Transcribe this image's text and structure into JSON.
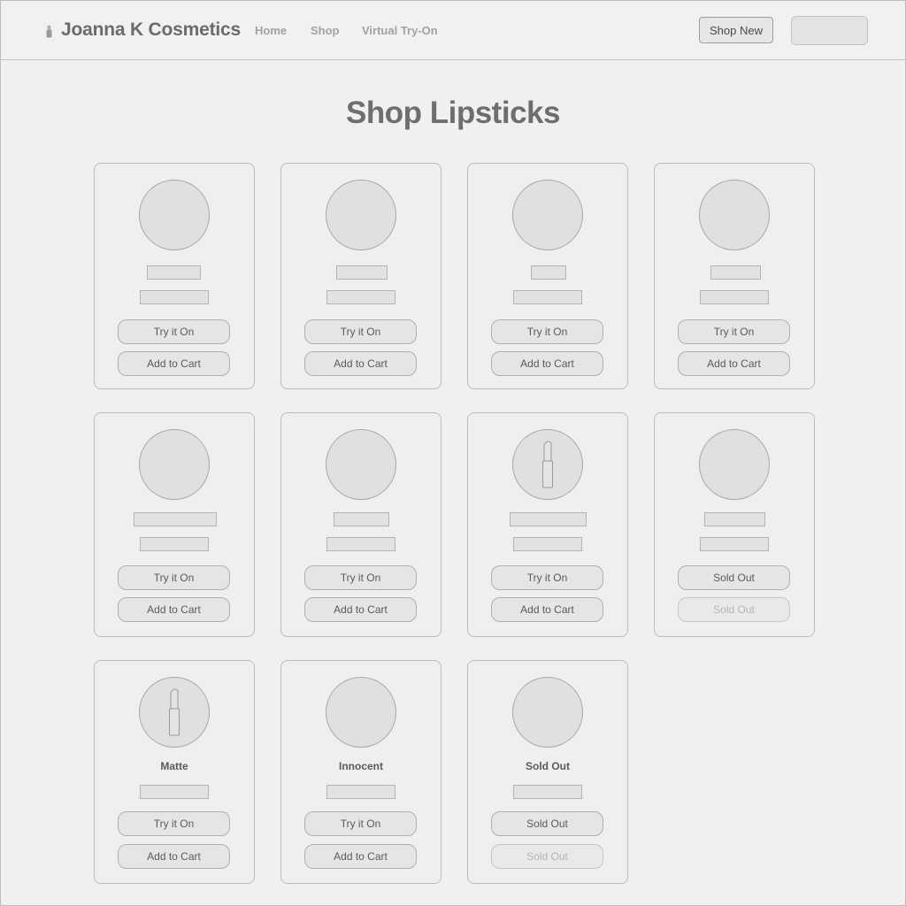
{
  "header": {
    "brand": "Joanna K Cosmetics",
    "nav": [
      "Home",
      "Shop",
      "Virtual Try-On"
    ],
    "shop_new_label": "Shop New"
  },
  "page": {
    "title": "Shop Lipsticks"
  },
  "products": [
    {
      "label": "",
      "primary_action": "Try it On",
      "secondary_action": "Add to Cart",
      "icon": "",
      "sold_out": false
    },
    {
      "label": "",
      "primary_action": "Try it On",
      "secondary_action": "Add to Cart",
      "icon": "",
      "sold_out": false
    },
    {
      "label": "",
      "primary_action": "Try it On",
      "secondary_action": "Add to Cart",
      "icon": "",
      "sold_out": false
    },
    {
      "label": "",
      "primary_action": "Try it On",
      "secondary_action": "Add to Cart",
      "icon": "",
      "sold_out": false
    },
    {
      "label": "",
      "primary_action": "Try it On",
      "secondary_action": "Add to Cart",
      "icon": "",
      "sold_out": false
    },
    {
      "label": "",
      "primary_action": "Try it On",
      "secondary_action": "Add to Cart",
      "icon": "",
      "sold_out": false
    },
    {
      "label": "",
      "primary_action": "Try it On",
      "secondary_action": "Add to Cart",
      "icon": "lipstick-icon",
      "sold_out": false
    },
    {
      "label": "",
      "primary_action": "Sold Out",
      "secondary_action": "Sold Out",
      "icon": "",
      "sold_out": true
    },
    {
      "label": "Matte",
      "primary_action": "Try it On",
      "secondary_action": "Add to Cart",
      "icon": "lipstick-icon",
      "sold_out": false
    },
    {
      "label": "Innocent",
      "primary_action": "Try it On",
      "secondary_action": "Add to Cart",
      "icon": "",
      "sold_out": false
    },
    {
      "label": "Sold Out",
      "primary_action": "Sold Out",
      "secondary_action": "Sold Out",
      "icon": "",
      "sold_out": true
    }
  ]
}
